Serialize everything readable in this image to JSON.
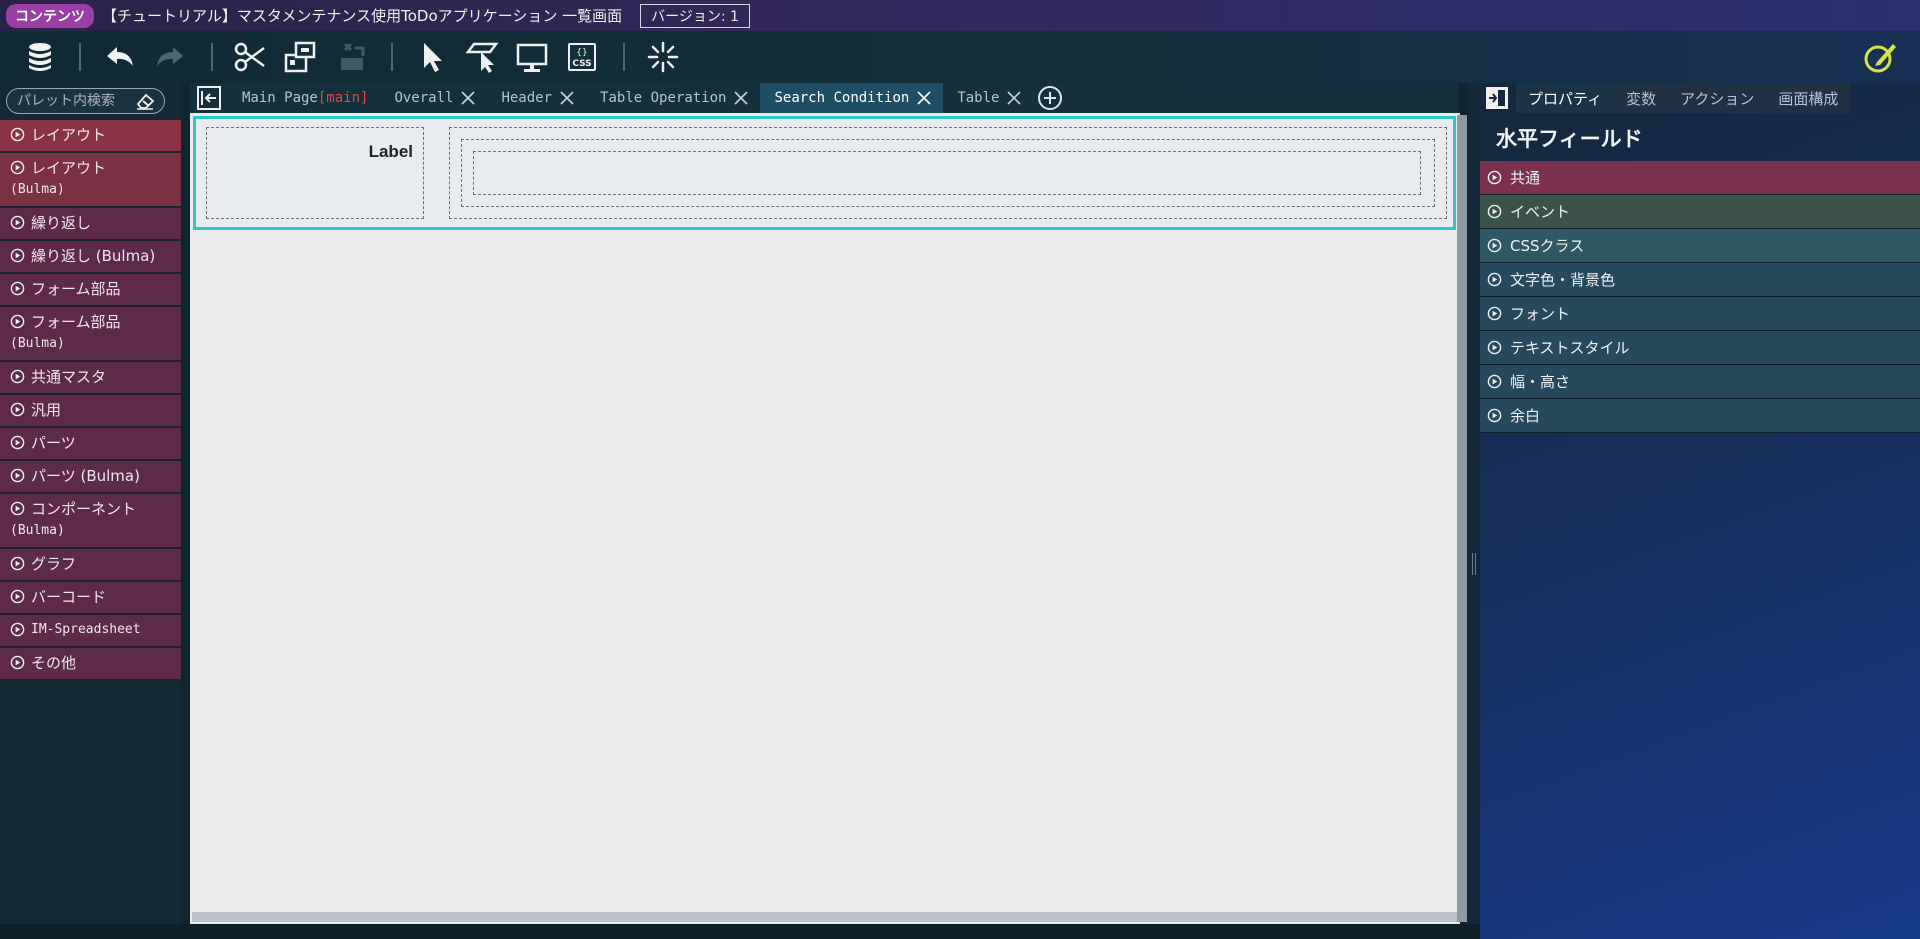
{
  "titlebar": {
    "badge": "コンテンツ",
    "title": "【チュートリアル】マスタメンテナンス使用ToDoアプリケーション 一覧画面",
    "version": "バージョン: 1"
  },
  "toolbar": {
    "icons": [
      "database-icon",
      "undo-icon",
      "redo-icon",
      "cut-icon",
      "component-icon",
      "remove-layer-icon",
      "select-pointer-icon",
      "region-select-icon",
      "preview-monitor-icon",
      "css-icon",
      "loading-icon",
      "edit-icon"
    ]
  },
  "palette": {
    "search_placeholder": "パレット内検索",
    "items": [
      {
        "label": "レイアウト"
      },
      {
        "label": "レイアウト",
        "sub": "(Bulma)"
      },
      {
        "label": "繰り返し"
      },
      {
        "label": "繰り返し (Bulma)"
      },
      {
        "label": "フォーム部品"
      },
      {
        "label": "フォーム部品",
        "sub": "(Bulma)"
      },
      {
        "label": "共通マスタ"
      },
      {
        "label": "汎用"
      },
      {
        "label": "パーツ"
      },
      {
        "label": "パーツ (Bulma)"
      },
      {
        "label": "コンポーネント",
        "sub": "(Bulma)"
      },
      {
        "label": "グラフ"
      },
      {
        "label": "バーコード"
      },
      {
        "label": "IM-Spreadsheet"
      },
      {
        "label": "その他"
      }
    ]
  },
  "tabs": [
    {
      "label": "Main Page",
      "tag": "[main]"
    },
    {
      "label": "Overall"
    },
    {
      "label": "Header"
    },
    {
      "label": "Table Operation"
    },
    {
      "label": "Search Condition",
      "active": true
    },
    {
      "label": "Table"
    }
  ],
  "canvas": {
    "label_text": "Label"
  },
  "right_panel": {
    "tabs": [
      "プロパティ",
      "変数",
      "アクション",
      "画面構成"
    ],
    "title": "水平フィールド",
    "sections": [
      {
        "label": "共通",
        "color": "#7a3150"
      },
      {
        "label": "イベント",
        "color": "#3a5248"
      },
      {
        "label": "CSSクラス",
        "color": "#2d5864"
      },
      {
        "label": "文字色・背景色",
        "color": "#27495e"
      },
      {
        "label": "フォント",
        "color": "#27495e"
      },
      {
        "label": "テキストスタイル",
        "color": "#27495e"
      },
      {
        "label": "幅・高さ",
        "color": "#27495e"
      },
      {
        "label": "余白",
        "color": "#27495e"
      }
    ]
  }
}
